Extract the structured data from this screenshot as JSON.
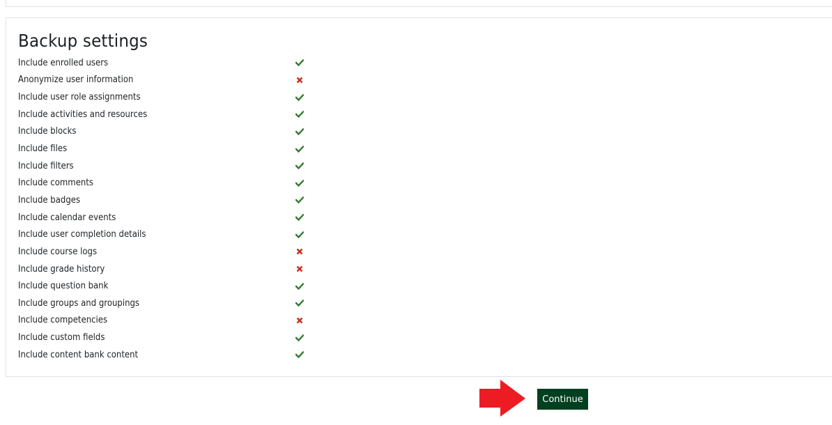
{
  "section": {
    "title": "Backup settings"
  },
  "settings": [
    {
      "label": "Include enrolled users",
      "enabled": true
    },
    {
      "label": "Anonymize user information",
      "enabled": false
    },
    {
      "label": "Include user role assignments",
      "enabled": true
    },
    {
      "label": "Include activities and resources",
      "enabled": true
    },
    {
      "label": "Include blocks",
      "enabled": true
    },
    {
      "label": "Include files",
      "enabled": true
    },
    {
      "label": "Include filters",
      "enabled": true
    },
    {
      "label": "Include comments",
      "enabled": true
    },
    {
      "label": "Include badges",
      "enabled": true
    },
    {
      "label": "Include calendar events",
      "enabled": true
    },
    {
      "label": "Include user completion details",
      "enabled": true
    },
    {
      "label": "Include course logs",
      "enabled": false
    },
    {
      "label": "Include grade history",
      "enabled": false
    },
    {
      "label": "Include question bank",
      "enabled": true
    },
    {
      "label": "Include groups and groupings",
      "enabled": true
    },
    {
      "label": "Include competencies",
      "enabled": false
    },
    {
      "label": "Include custom fields",
      "enabled": true
    },
    {
      "label": "Include content bank content",
      "enabled": true
    }
  ],
  "icons": {
    "enabled": "check-icon",
    "disabled": "cross-icon"
  },
  "colors": {
    "check": "#357a32",
    "cross": "#ca3120",
    "button_bg": "#004020",
    "arrow": "#ed1c24"
  },
  "actions": {
    "continue_label": "Continue"
  }
}
